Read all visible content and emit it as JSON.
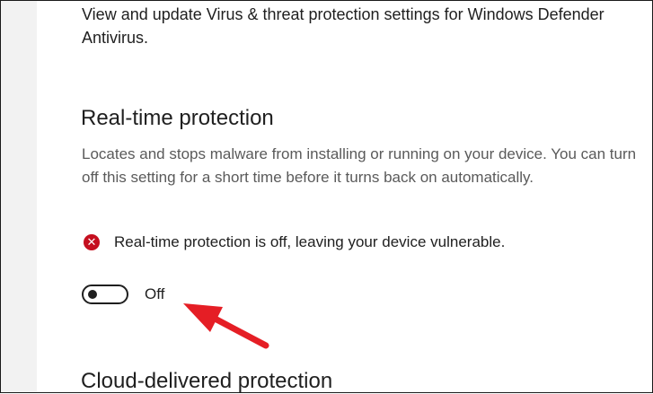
{
  "intro": {
    "text": "View and update Virus & threat protection settings for Windows Defender Antivirus."
  },
  "realtime": {
    "title": "Real-time protection",
    "description": "Locates and stops malware from installing or running on your device. You can turn off this setting for a short time before it turns back on automatically.",
    "status_text": "Real-time protection is off, leaving your device vulnerable.",
    "status_icon": "error-icon",
    "status_color": "#c50f1f",
    "toggle": {
      "state": "Off",
      "on": false
    }
  },
  "next_section": {
    "title": "Cloud-delivered protection"
  },
  "annotation": {
    "icon": "red-arrow-icon",
    "color": "#e51e25"
  }
}
